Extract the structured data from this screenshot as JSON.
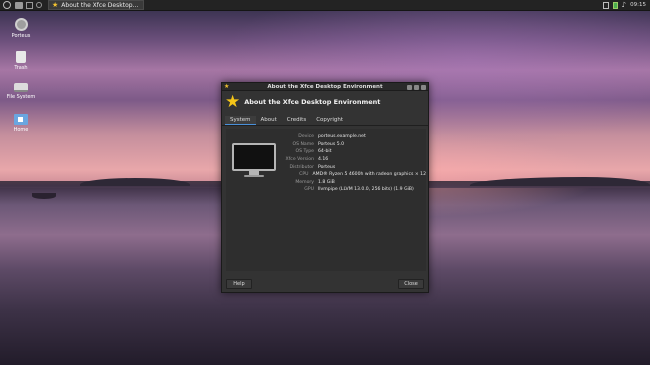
{
  "panel": {
    "task_title": "About the Xfce Desktop...",
    "clock": "09:15"
  },
  "desktop_icons": [
    {
      "label": "Porteus",
      "icon": "settings-icon"
    },
    {
      "label": "Trash",
      "icon": "trash-icon"
    },
    {
      "label": "File System",
      "icon": "drive-icon"
    },
    {
      "label": "Home",
      "icon": "home-folder-icon"
    }
  ],
  "dialog": {
    "window_title": "About the Xfce Desktop Environment",
    "heading": "About the Xfce Desktop Environment",
    "tabs": [
      "System",
      "About",
      "Credits",
      "Copyright"
    ],
    "active_tab": "System",
    "info": [
      {
        "label": "Device",
        "value": "porteus.example.net"
      },
      {
        "label": "OS Name",
        "value": "Porteus 5.0"
      },
      {
        "label": "OS Type",
        "value": "64-bit"
      },
      {
        "label": "Xfce Version",
        "value": "4.16"
      },
      {
        "label": "Distributor",
        "value": "Porteus"
      },
      {
        "label": "CPU",
        "value": "AMD® Ryzen 5 4600h with radeon graphics × 12"
      },
      {
        "label": "Memory",
        "value": "1.8 GiB"
      },
      {
        "label": "GPU",
        "value": "llvmpipe (LLVM 13.0.0, 256 bits) (1.9 GiB)"
      }
    ],
    "help_label": "Help",
    "close_label": "Close"
  },
  "colors": {
    "accent_star": "#f5c518",
    "tab_underline": "#4a90d9",
    "dialog_bg": "#333333"
  }
}
